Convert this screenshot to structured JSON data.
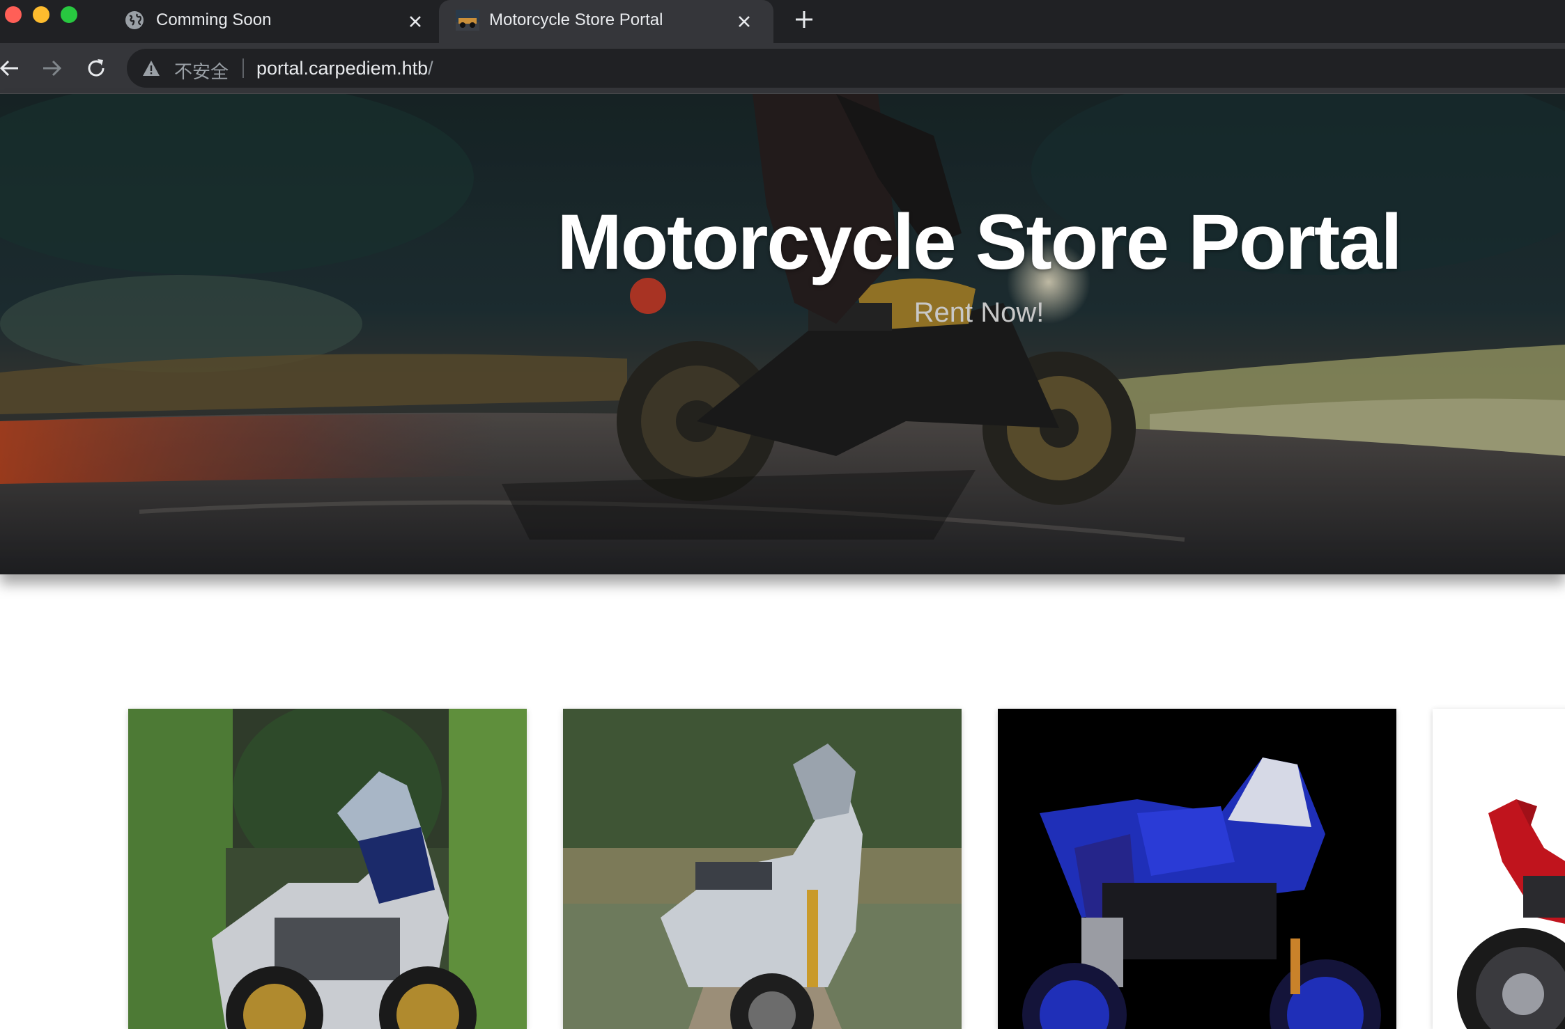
{
  "browser": {
    "tabs": [
      {
        "title": "Comming Soon",
        "active": false,
        "icon": "globe-icon"
      },
      {
        "title": "Motorcycle Store Portal",
        "active": true,
        "icon": "site-thumbnail-icon"
      }
    ],
    "address_bar": {
      "security_label": "不安全",
      "url_host": "portal.carpediem.htb",
      "url_path": "/"
    }
  },
  "hero": {
    "title": "Motorcycle Store Portal",
    "subtitle": "Rent Now!"
  },
  "products": [
    {
      "image": "adventure-motorcycle-forest"
    },
    {
      "image": "scooter-motorcycle-dirt-road"
    },
    {
      "image": "blue-sport-motorcycle"
    },
    {
      "image": "red-sport-motorcycle"
    }
  ],
  "colors": {
    "tabbar": "#202124",
    "toolbar": "#35363a",
    "hero_title": "#ffffff",
    "hero_subtitle": "#c8c8c8"
  }
}
